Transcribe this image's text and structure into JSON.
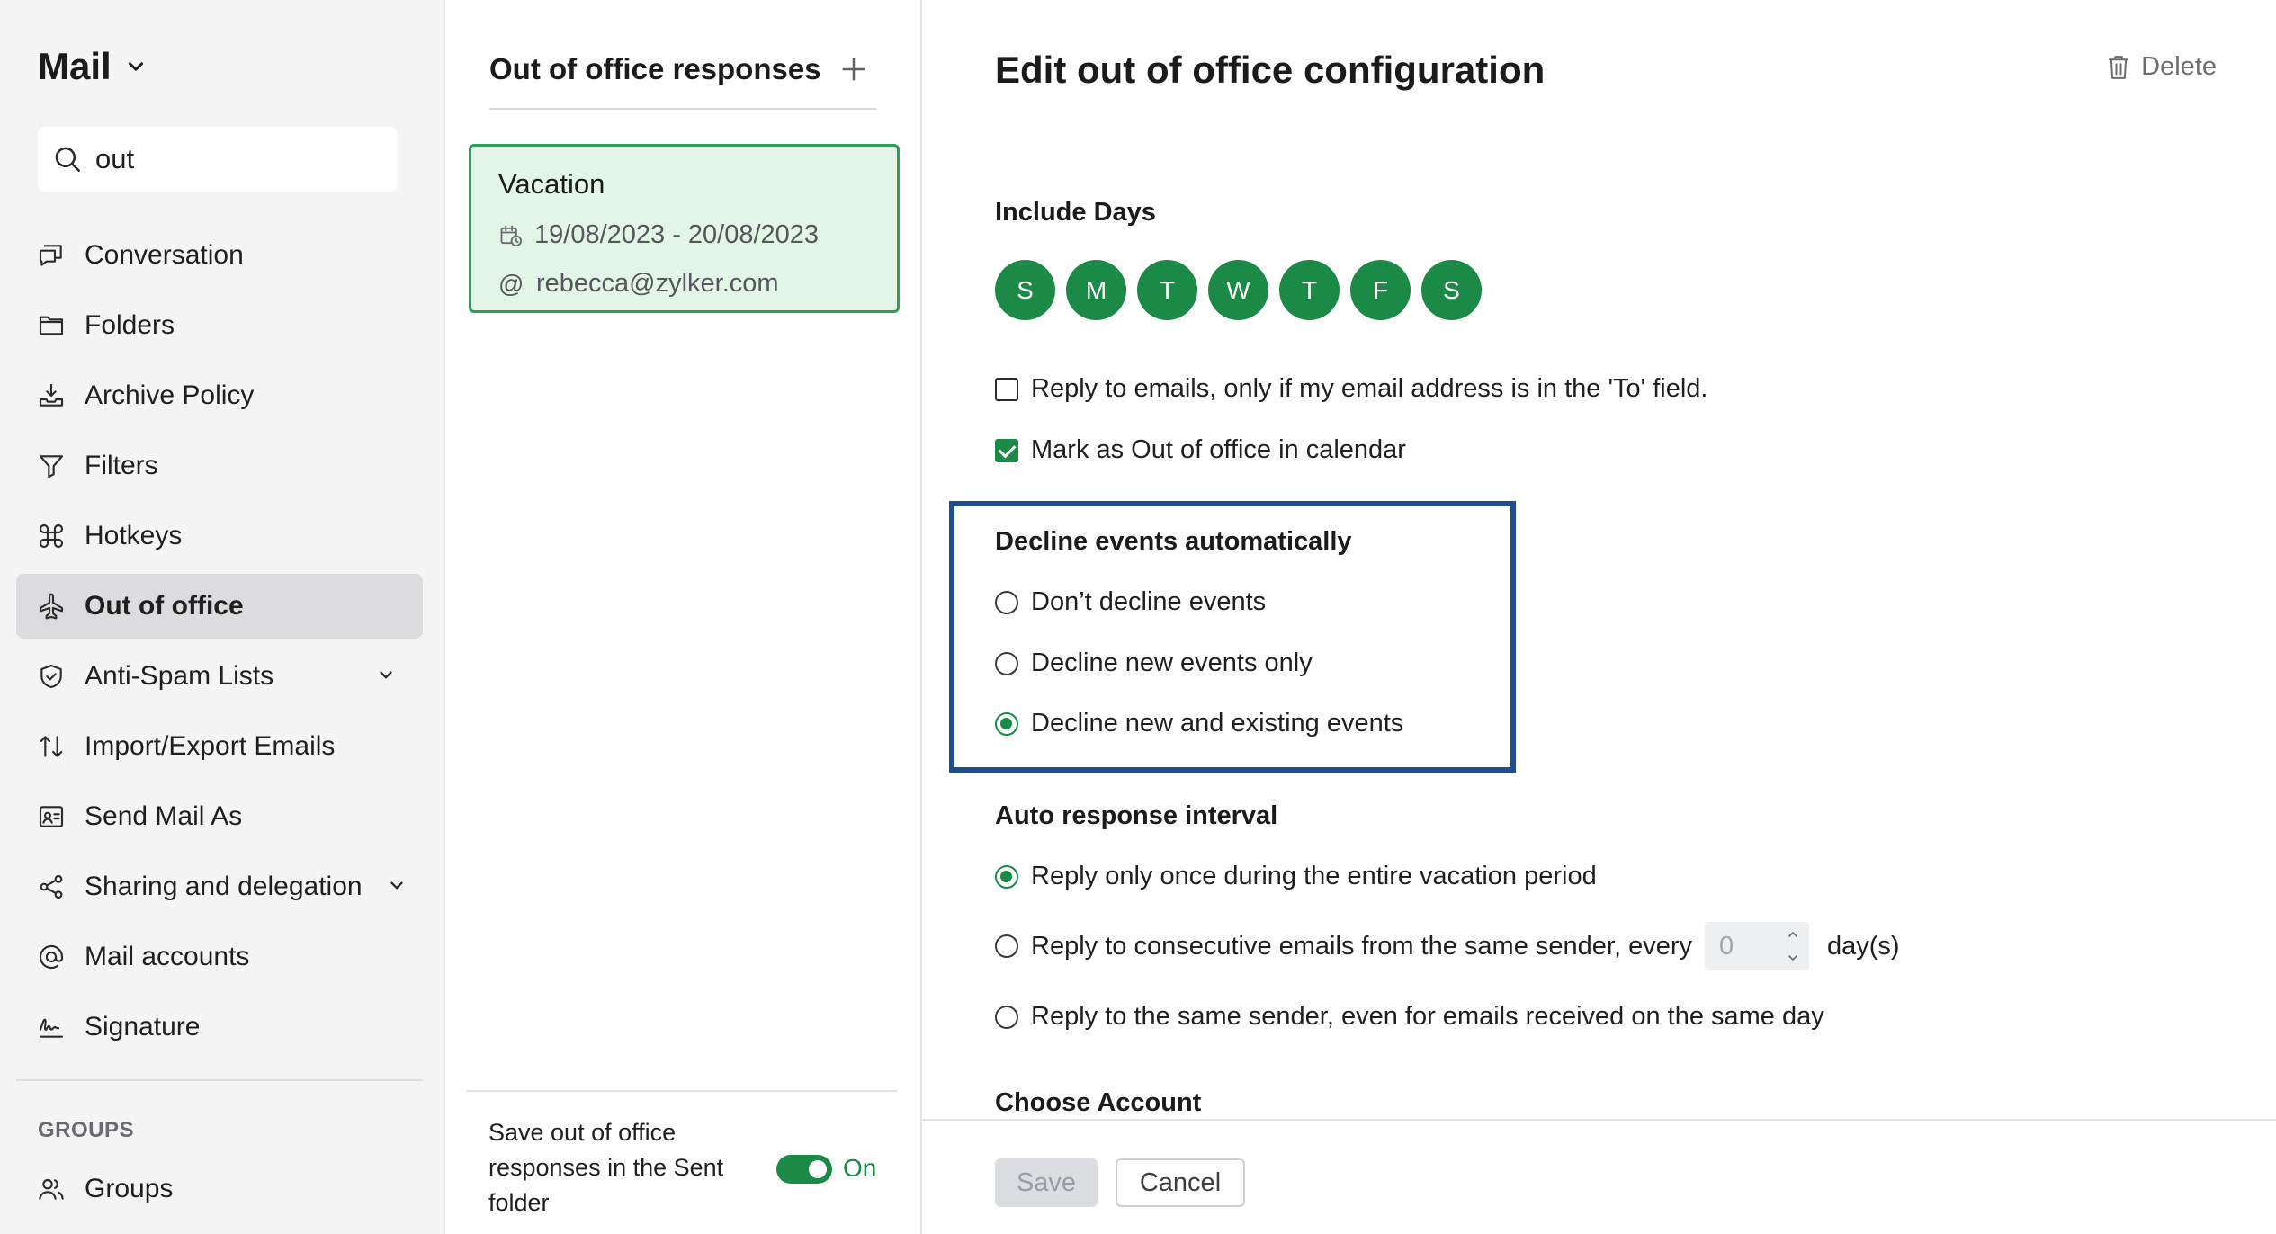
{
  "sidebar": {
    "app_title": "Mail",
    "search": {
      "value": "out",
      "placeholder": ""
    },
    "items": [
      {
        "label": "Conversation",
        "icon": "conversation-icon"
      },
      {
        "label": "Folders",
        "icon": "folder-icon"
      },
      {
        "label": "Archive Policy",
        "icon": "archive-icon"
      },
      {
        "label": "Filters",
        "icon": "filter-icon"
      },
      {
        "label": "Hotkeys",
        "icon": "command-key-icon"
      },
      {
        "label": "Out of office",
        "icon": "airplane-icon",
        "active": true
      },
      {
        "label": "Anti-Spam Lists",
        "icon": "shield-icon",
        "expandable": true
      },
      {
        "label": "Import/Export Emails",
        "icon": "import-export-icon"
      },
      {
        "label": "Send Mail As",
        "icon": "id-card-icon"
      },
      {
        "label": "Sharing and delegation",
        "icon": "share-icon",
        "expandable": true
      },
      {
        "label": "Mail accounts",
        "icon": "at-sign-icon"
      },
      {
        "label": "Signature",
        "icon": "signature-icon"
      }
    ],
    "groups_label": "GROUPS",
    "groups_item": {
      "label": "Groups",
      "icon": "users-icon"
    }
  },
  "list": {
    "title": "Out of office responses",
    "card": {
      "name": "Vacation",
      "dates": "19/08/2023 - 20/08/2023",
      "email": "rebecca@zylker.com",
      "at_symbol": "@"
    },
    "footer": {
      "text": "Save out of office responses in the Sent folder",
      "toggle_label": "On",
      "toggle_on": true
    }
  },
  "main": {
    "title": "Edit out of office configuration",
    "delete_label": "Delete",
    "include_days": {
      "title": "Include Days",
      "days": [
        "S",
        "M",
        "T",
        "W",
        "T",
        "F",
        "S"
      ]
    },
    "checkboxes": [
      {
        "label": "Reply to emails, only if my email address is in the 'To' field.",
        "checked": false
      },
      {
        "label": "Mark as Out of office in calendar",
        "checked": true
      }
    ],
    "decline": {
      "title": "Decline events automatically",
      "options": [
        {
          "label": "Don’t decline events",
          "selected": false
        },
        {
          "label": "Decline new events only",
          "selected": false
        },
        {
          "label": "Decline new and existing events",
          "selected": true
        }
      ]
    },
    "interval": {
      "title": "Auto response interval",
      "options": [
        {
          "label": "Reply only once during the entire vacation period",
          "selected": true
        },
        {
          "label": "Reply to consecutive emails from the same sender, every",
          "selected": false
        },
        {
          "label": "Reply to the same sender, even for emails received on the same day",
          "selected": false
        }
      ],
      "days_value": "0",
      "days_unit": "day(s)"
    },
    "choose_account_title": "Choose Account",
    "save_label": "Save",
    "cancel_label": "Cancel"
  },
  "colors": {
    "accent_green": "#1a8a46",
    "card_bg": "#e3f5e7",
    "highlight_border": "#1d4f91"
  }
}
